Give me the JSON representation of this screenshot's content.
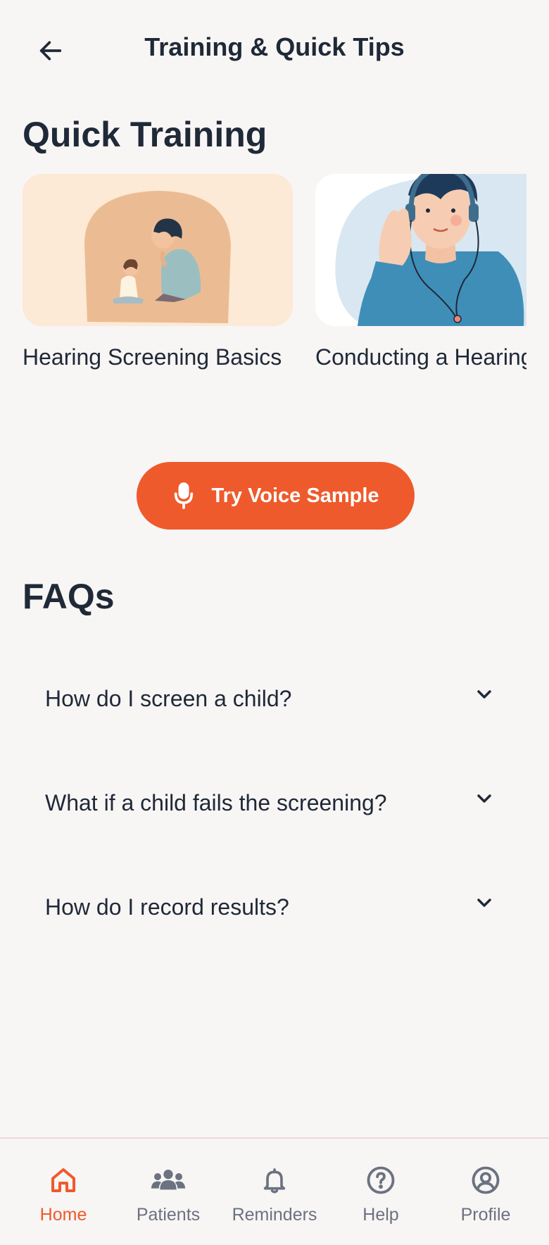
{
  "header": {
    "title": "Training & Quick Tips",
    "back_icon": "arrow-left-icon"
  },
  "training": {
    "section_title": "Quick Training",
    "cards": [
      {
        "title": "Hearing Screening Basics",
        "image": "child-and-adult-listening-illustration"
      },
      {
        "title": "Conducting a Hearing Test",
        "image": "person-with-headphones-illustration"
      }
    ]
  },
  "voice_sample": {
    "label": "Try Voice Sample",
    "icon": "microphone-icon",
    "color": "#ee5a2c"
  },
  "faqs": {
    "section_title": "FAQs",
    "items": [
      {
        "question": "How do I screen a child?",
        "icon": "chevron-down-icon"
      },
      {
        "question": "What if a child fails the screening?",
        "icon": "chevron-down-icon"
      },
      {
        "question": "How do I record results?",
        "icon": "chevron-down-icon"
      }
    ]
  },
  "bottom_nav": {
    "active": "Home",
    "items": [
      {
        "label": "Home",
        "icon": "home-icon"
      },
      {
        "label": "Patients",
        "icon": "users-icon"
      },
      {
        "label": "Reminders",
        "icon": "bell-icon"
      },
      {
        "label": "Help",
        "icon": "help-circle-icon"
      },
      {
        "label": "Profile",
        "icon": "profile-icon"
      }
    ]
  },
  "colors": {
    "accent": "#ee5a2c",
    "text": "#1f2937",
    "muted": "#6b7280",
    "background": "#f8f5f5"
  }
}
